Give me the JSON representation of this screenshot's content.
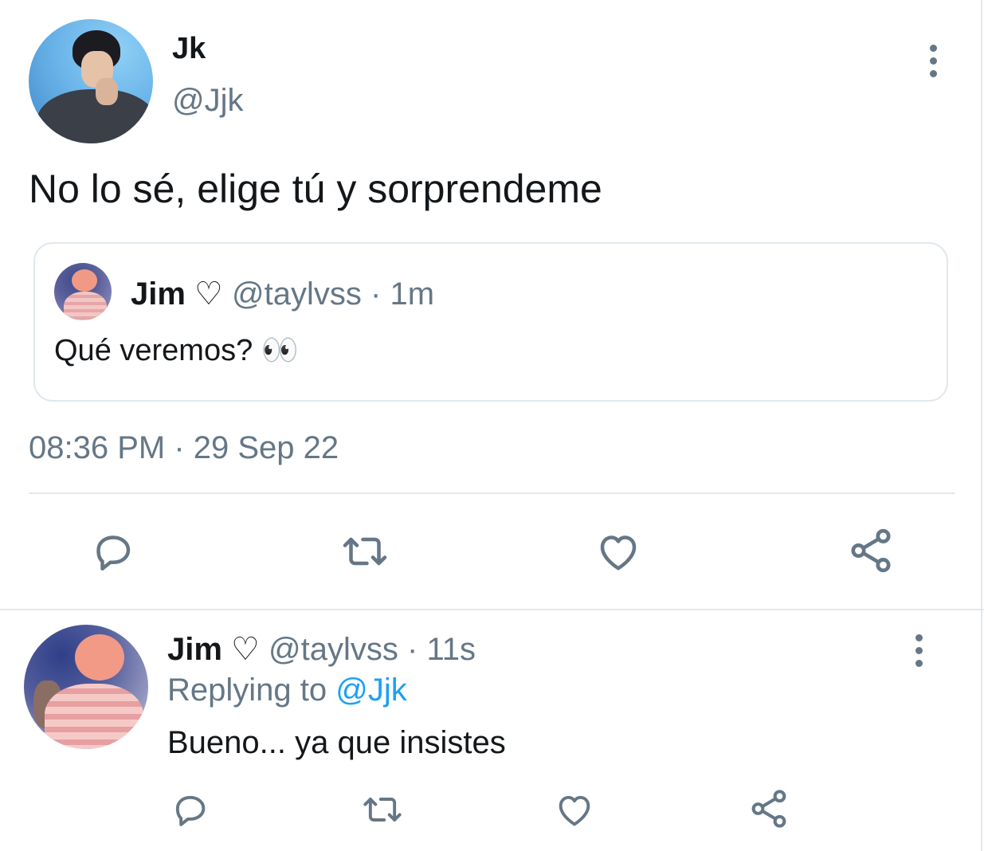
{
  "tweet": {
    "author_name": "Jk",
    "author_handle": "@Jjk",
    "text": "No lo sé, elige tú y sorprendeme",
    "timestamp": "08:36 PM · 29 Sep 22",
    "quoted": {
      "author_name": "Jim ♡",
      "author_handle": "@taylvss",
      "time": "· 1m",
      "text": "Qué veremos? 👀"
    },
    "actions": [
      "reply-icon",
      "retweet-icon",
      "like-icon",
      "share-icon"
    ]
  },
  "reply": {
    "author_name": "Jim ♡",
    "author_handle": "@taylvss",
    "time": "· 11s",
    "replying_prefix": "Replying to",
    "replying_to": "@Jjk",
    "text": "Bueno... ya que insistes",
    "actions": [
      "reply-icon",
      "retweet-icon",
      "like-icon",
      "share-icon"
    ]
  },
  "colors": {
    "text_primary": "#14171a",
    "text_secondary": "#657786",
    "link": "#1da1f2",
    "border": "#e1e8ed"
  }
}
